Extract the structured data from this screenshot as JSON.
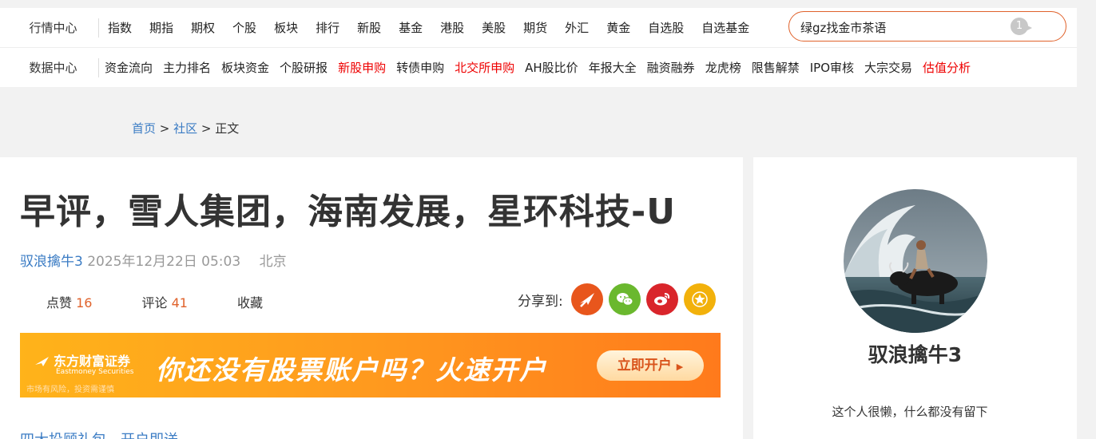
{
  "nav": {
    "row1_label": "行情中心",
    "row1_items": [
      "指数",
      "期指",
      "期权",
      "个股",
      "板块",
      "排行",
      "新股",
      "基金",
      "港股",
      "美股",
      "期货",
      "外汇",
      "黄金",
      "自选股",
      "自选基金"
    ],
    "row2_label": "数据中心",
    "row2_items": [
      {
        "label": "资金流向",
        "highlight": false
      },
      {
        "label": "主力排名",
        "highlight": false
      },
      {
        "label": "板块资金",
        "highlight": false
      },
      {
        "label": "个股研报",
        "highlight": false
      },
      {
        "label": "新股申购",
        "highlight": true
      },
      {
        "label": "转债申购",
        "highlight": false
      },
      {
        "label": "北交所申购",
        "highlight": true
      },
      {
        "label": "AH股比价",
        "highlight": false
      },
      {
        "label": "年报大全",
        "highlight": false
      },
      {
        "label": "融资融券",
        "highlight": false
      },
      {
        "label": "龙虎榜",
        "highlight": false
      },
      {
        "label": "限售解禁",
        "highlight": false
      },
      {
        "label": "IPO审核",
        "highlight": false
      },
      {
        "label": "大宗交易",
        "highlight": false
      },
      {
        "label": "估值分析",
        "highlight": true
      }
    ]
  },
  "search": {
    "value": "绿gz找金市茶语",
    "badge": "1"
  },
  "breadcrumb": {
    "home": "首页",
    "sep1": " > ",
    "community": "社区",
    "sep2": " > ",
    "current": "正文"
  },
  "article": {
    "title": "早评，雪人集团，海南发展，星环科技-U",
    "author": "驭浪擒牛3",
    "datetime": "2025年12月22日 05:03",
    "location": "北京",
    "like_label": "点赞",
    "like_count": "16",
    "comment_label": "评论",
    "comment_count": "41",
    "favorite_label": "收藏",
    "share_label": "分享到:",
    "teaser": "四大投顾礼包，开户即送"
  },
  "banner": {
    "brand": "东方财富证券",
    "brand_en": "Eastmoney Securities",
    "risk_note": "市场有风险，投资需谨慎",
    "slogan": "你还没有股票账户吗？火速开户",
    "button": "立即开户"
  },
  "sidebar": {
    "username": "驭浪擒牛3",
    "bio": "这个人很懒，什么都没有留下"
  },
  "colors": {
    "accent_orange": "#e0622b",
    "link_blue": "#3b7cc4",
    "highlight_red": "#ee0000",
    "share_east": "#e8561c",
    "share_wechat": "#6ab82e",
    "share_weibo": "#d9252b",
    "share_star": "#f2b10b"
  }
}
